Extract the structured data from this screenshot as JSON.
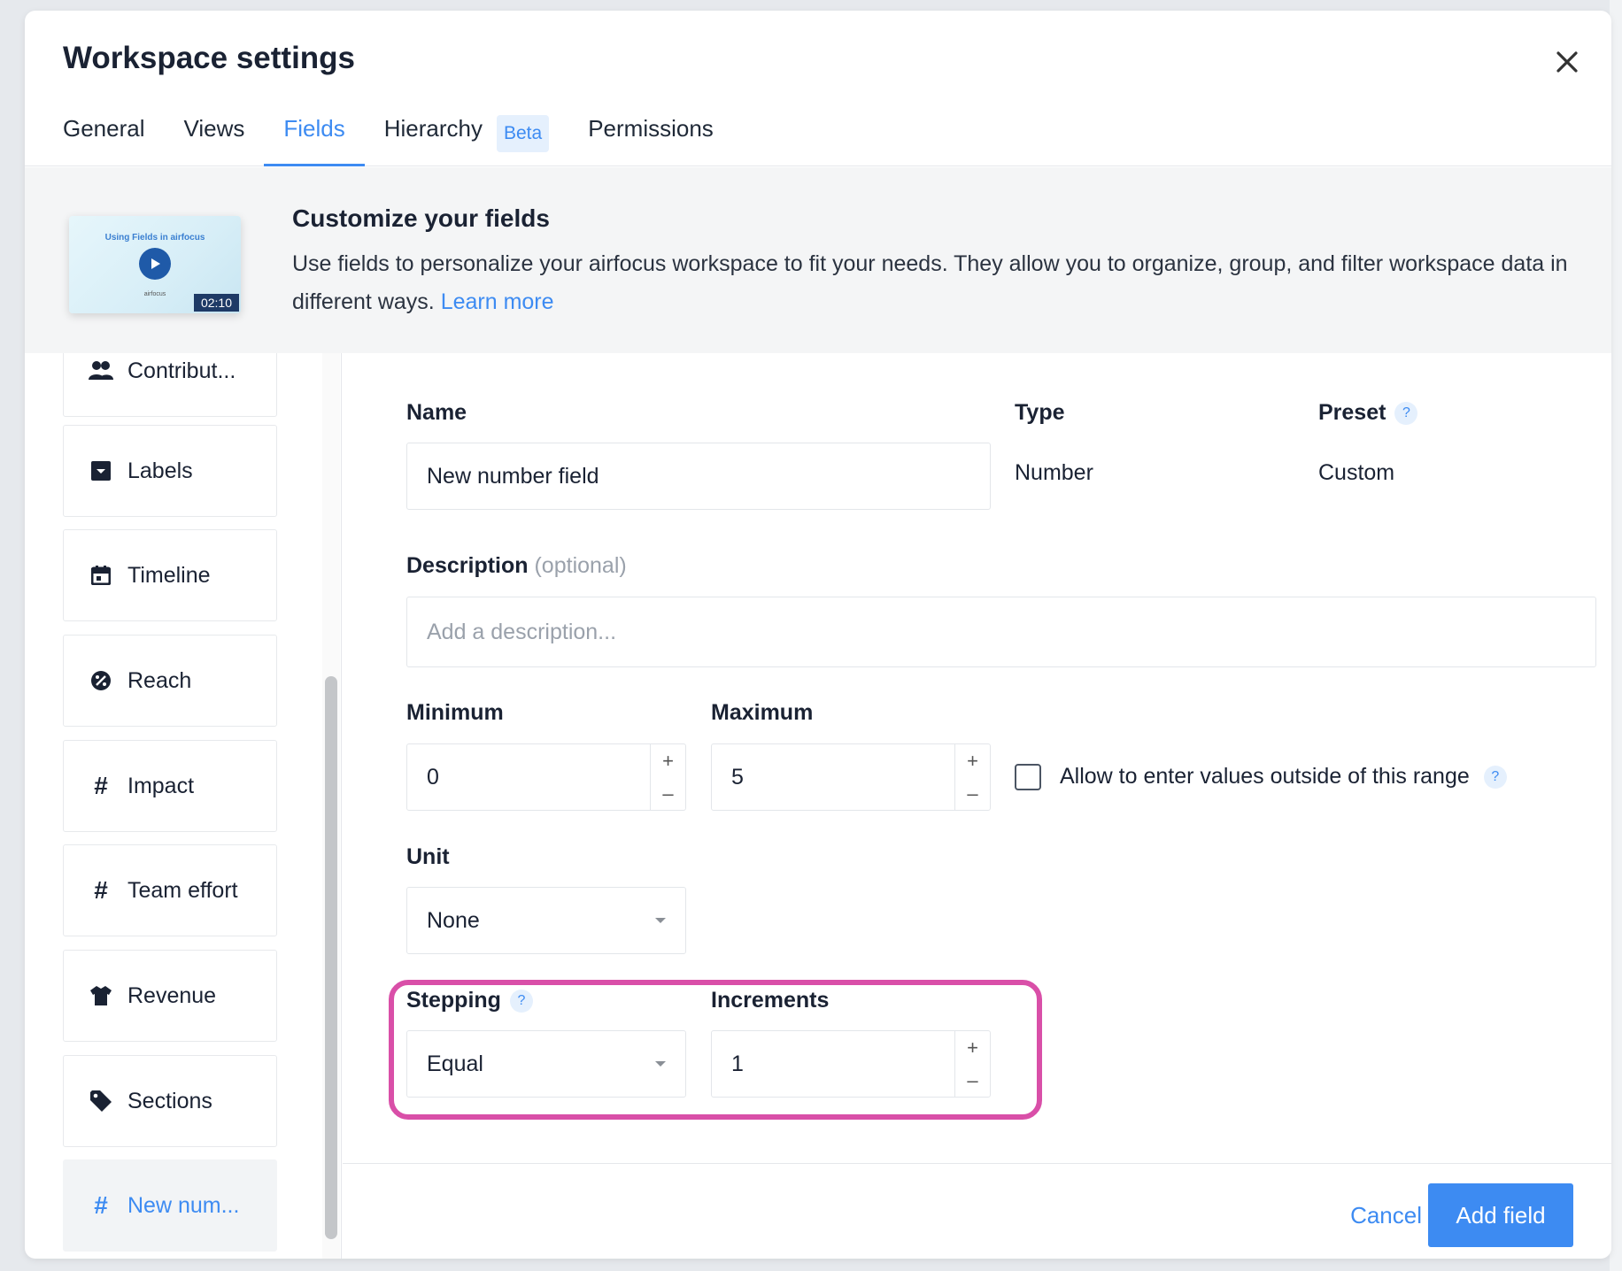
{
  "modal": {
    "title": "Workspace settings"
  },
  "tabs": [
    {
      "label": "General"
    },
    {
      "label": "Views"
    },
    {
      "label": "Fields"
    },
    {
      "label": "Hierarchy",
      "badge": "Beta"
    },
    {
      "label": "Permissions"
    }
  ],
  "banner": {
    "video_title": "Using Fields in airfocus",
    "video_brand": "airfocus",
    "video_duration": "02:10",
    "title": "Customize your fields",
    "text": "Use fields to personalize your airfocus workspace to fit your needs. They allow you to organize, group, and filter workspace data in different ways.",
    "link": "Learn more"
  },
  "sidebar": {
    "items": [
      {
        "label": "Contribut...",
        "icon": "people-icon"
      },
      {
        "label": "Labels",
        "icon": "label-dropdown-icon"
      },
      {
        "label": "Timeline",
        "icon": "calendar-icon"
      },
      {
        "label": "Reach",
        "icon": "percent-icon"
      },
      {
        "label": "Impact",
        "icon": "hash-icon"
      },
      {
        "label": "Team effort",
        "icon": "hash-icon"
      },
      {
        "label": "Revenue",
        "icon": "shirt-icon"
      },
      {
        "label": "Sections",
        "icon": "tag-icon"
      },
      {
        "label": "New num...",
        "icon": "hash-icon",
        "selected": true
      }
    ]
  },
  "form": {
    "name_label": "Name",
    "name_value": "New number field",
    "type_label": "Type",
    "type_value": "Number",
    "preset_label": "Preset",
    "preset_value": "Custom",
    "description_label": "Description",
    "description_optional": "(optional)",
    "description_placeholder": "Add a description...",
    "minimum_label": "Minimum",
    "minimum_value": "0",
    "maximum_label": "Maximum",
    "maximum_value": "5",
    "allow_outside_label": "Allow to enter values outside of this range",
    "allow_outside_checked": false,
    "unit_label": "Unit",
    "unit_value": "None",
    "stepping_label": "Stepping",
    "stepping_value": "Equal",
    "increments_label": "Increments",
    "increments_value": "1",
    "help_glyph": "?",
    "plus_glyph": "+",
    "minus_glyph": "–"
  },
  "footer": {
    "cancel_label": "Cancel",
    "add_label": "Add field"
  },
  "colors": {
    "accent": "#3d8bf2",
    "highlight": "#d94fa8"
  }
}
